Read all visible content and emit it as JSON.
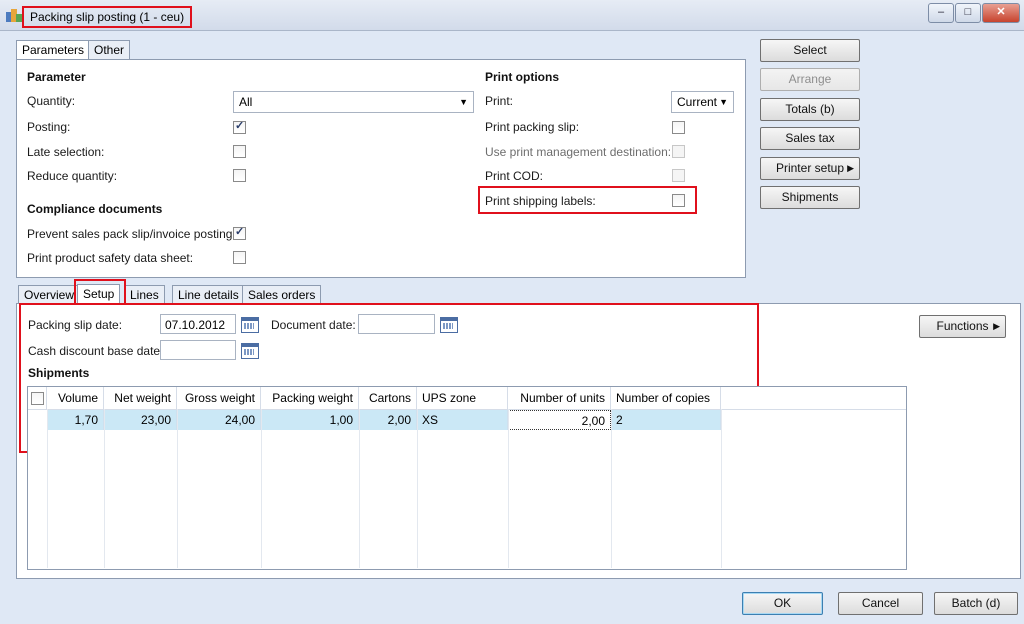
{
  "window": {
    "title": "Packing slip posting (1 - ceu)",
    "minimize": "–",
    "maximize": "□",
    "close": "✕"
  },
  "top_tabs": [
    "Parameters",
    "Other"
  ],
  "parameter": {
    "heading": "Parameter",
    "quantity_label": "Quantity:",
    "quantity_value": "All",
    "posting_label": "Posting:",
    "posting_checked": true,
    "late_selection_label": "Late selection:",
    "late_selection_checked": false,
    "reduce_quantity_label": "Reduce quantity:",
    "reduce_quantity_checked": false
  },
  "compliance": {
    "heading": "Compliance documents",
    "prevent_label": "Prevent sales pack slip/invoice posting:",
    "prevent_checked": true,
    "safety_label": "Print product safety data sheet:",
    "safety_checked": false
  },
  "print_options": {
    "heading": "Print options",
    "print_label": "Print:",
    "print_value": "Current",
    "packing_slip_label": "Print packing slip:",
    "use_mgmt_label": "Use print management destination:",
    "cod_label": "Print COD:",
    "shipping_labels_label": "Print shipping labels:"
  },
  "side_buttons": {
    "select": "Select",
    "arrange": "Arrange",
    "totals": "Totals (b)",
    "sales_tax": "Sales tax",
    "printer_setup": "Printer setup",
    "shipments": "Shipments"
  },
  "lower_tabs": [
    "Overview",
    "Setup",
    "Lines",
    "Line details",
    "Sales orders"
  ],
  "setup": {
    "packing_slip_date_label": "Packing slip date:",
    "packing_slip_date": "07.10.2012",
    "document_date_label": "Document date:",
    "document_date": "",
    "cash_discount_label": "Cash discount base date:",
    "cash_discount_date": "",
    "shipments_heading": "Shipments"
  },
  "functions_button": "Functions",
  "shipments_grid": {
    "columns": [
      "Volume",
      "Net weight",
      "Gross weight",
      "Packing weight",
      "Cartons",
      "UPS zone",
      "Number of units",
      "Number of copies"
    ],
    "rows": [
      [
        "1,70",
        "23,00",
        "24,00",
        "1,00",
        "2,00",
        "XS",
        "2,00",
        "2"
      ]
    ]
  },
  "footer": {
    "ok": "OK",
    "cancel": "Cancel",
    "batch": "Batch (d)"
  },
  "colors": {
    "highlight_border": "#e0101c",
    "selected_row": "#cbe8f6"
  }
}
